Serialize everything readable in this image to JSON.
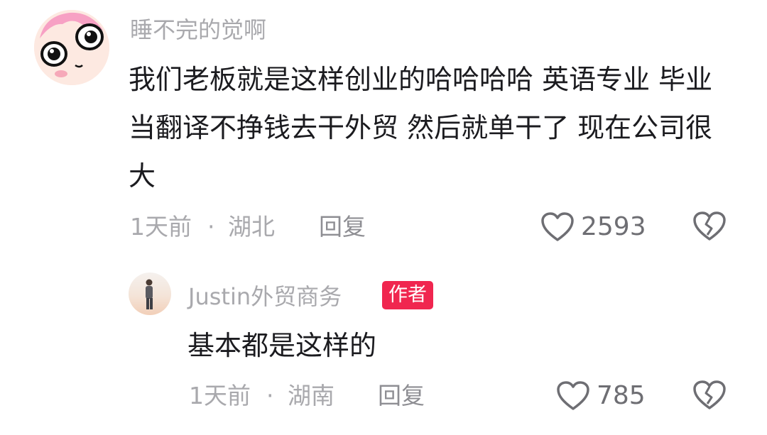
{
  "comments": [
    {
      "username": "睡不完的觉啊",
      "text": "我们老板就是这样创业的哈哈哈哈 英语专业 毕业当翻译不挣钱去干外贸 然后就单干了 现在公司很大",
      "time": "1天前",
      "separator": "·",
      "location": "湖北",
      "reply_label": "回复",
      "like_count": "2593",
      "icons": {
        "like": "heart-outline-icon",
        "dislike": "broken-heart-icon"
      }
    }
  ],
  "replies": [
    {
      "username": "Justin外贸商务",
      "badge": "作者",
      "text": "基本都是这样的",
      "time": "1天前",
      "separator": "·",
      "location": "湖南",
      "reply_label": "回复",
      "like_count": "785",
      "icons": {
        "like": "heart-outline-icon",
        "dislike": "broken-heart-icon"
      }
    }
  ],
  "colors": {
    "badge": "#f0264f",
    "muted_text": "#a9a9ad",
    "body_text": "#1b1b1f"
  }
}
